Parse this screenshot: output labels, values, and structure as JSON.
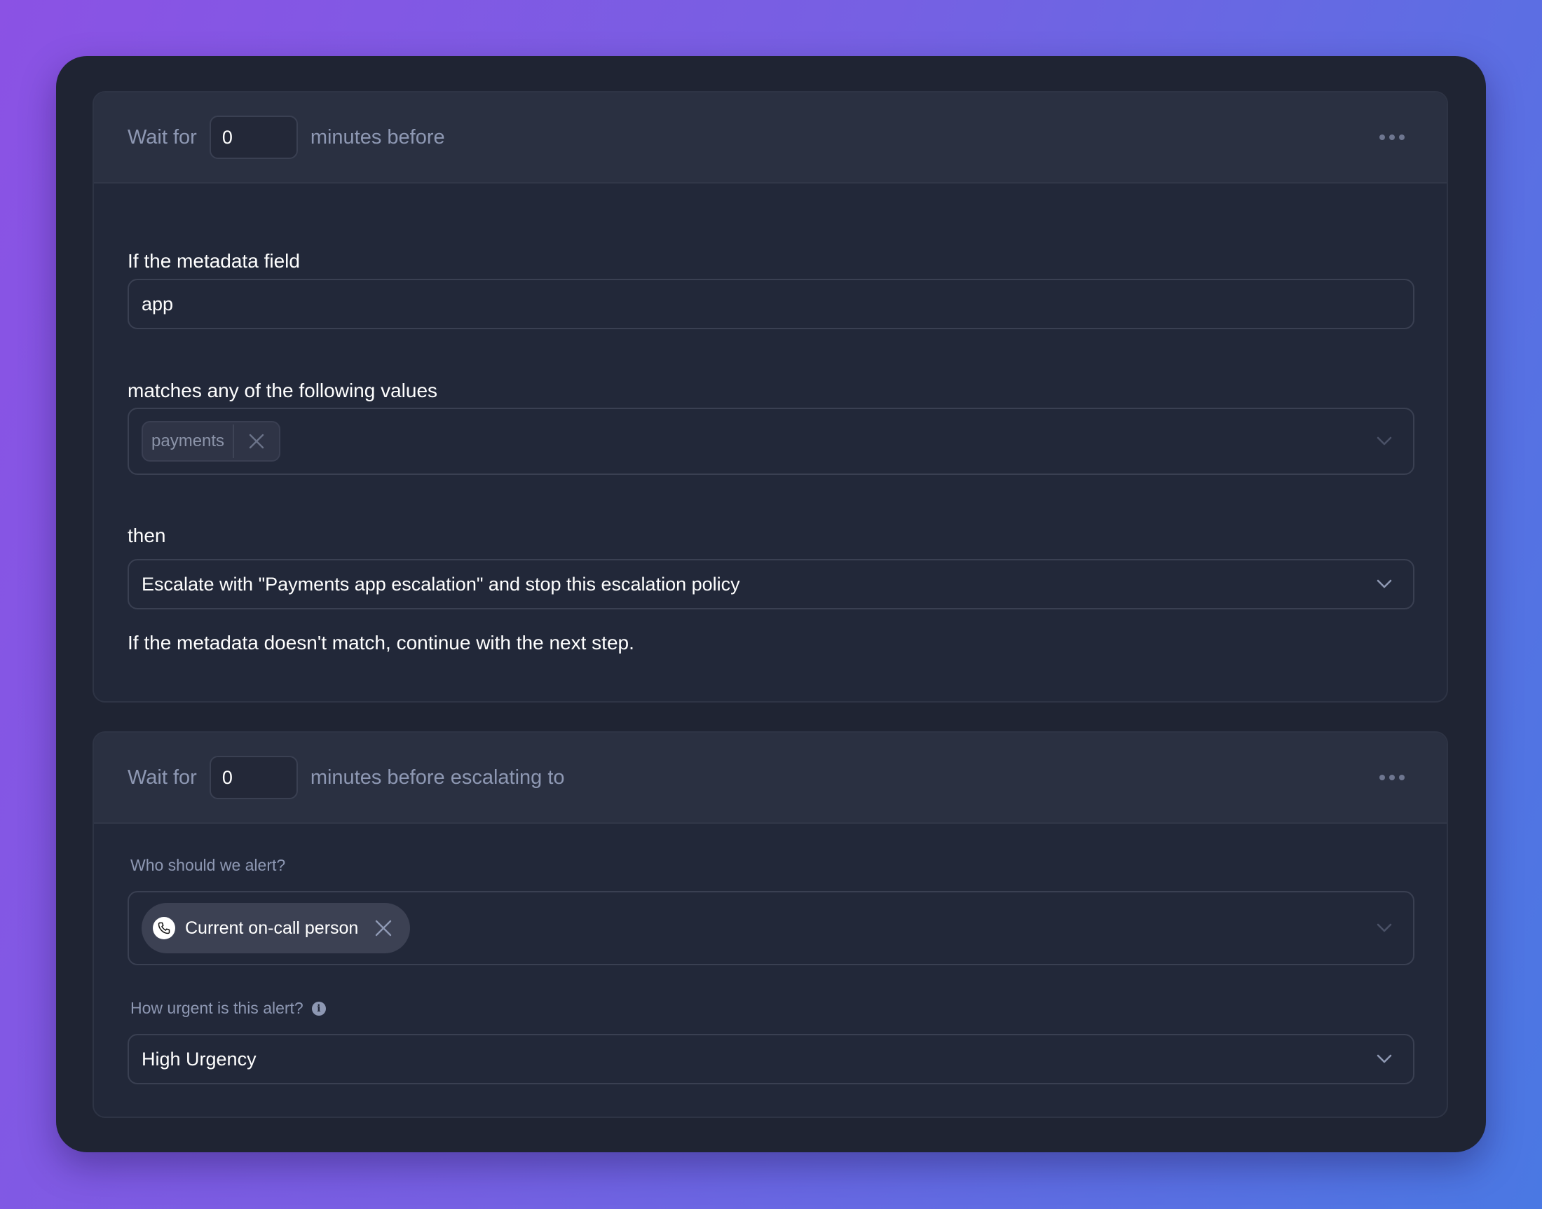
{
  "steps": [
    {
      "header": {
        "prefix": "Wait for",
        "minutes_value": "0",
        "suffix": "minutes before",
        "more_icon": "more-horizontal-icon"
      },
      "metadata_field_label": "If the metadata field",
      "metadata_field_value": "app",
      "matches_label": "matches any of the following values",
      "match_values": [
        "payments"
      ],
      "then_label": "then",
      "then_value": "Escalate with \"Payments app escalation\" and stop this escalation policy",
      "help_text": "If the metadata doesn't match, continue with the next step."
    },
    {
      "header": {
        "prefix": "Wait for",
        "minutes_value": "0",
        "suffix": "minutes before escalating to",
        "more_icon": "more-horizontal-icon"
      },
      "alert_label": "Who should we alert?",
      "alert_targets": [
        {
          "label": "Current on-call person",
          "icon": "phone-icon"
        }
      ],
      "urgency_label": "How urgent is this alert?",
      "urgency_info_icon": "info-icon",
      "urgency_info_glyph": "i",
      "urgency_value": "High Urgency"
    }
  ],
  "colors": {
    "background_start": "#8b52e4",
    "background_end": "#4a78e3",
    "card": "#1f2433",
    "panel": "#222839",
    "panel_header": "#2a3041",
    "muted_text": "#8e98b3",
    "text": "#ffffff"
  }
}
